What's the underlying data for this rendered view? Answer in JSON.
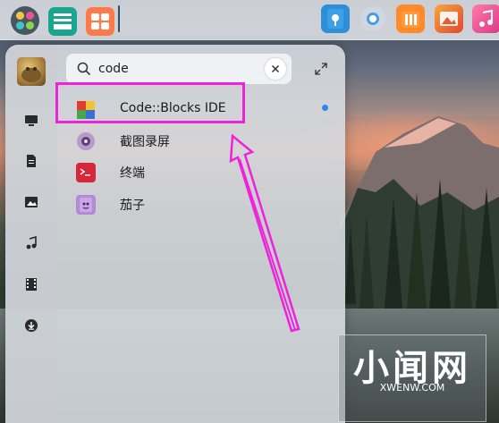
{
  "dock": {
    "apps": [
      {
        "name": "launcher"
      },
      {
        "name": "multitask-view"
      },
      {
        "name": "app-store-grid"
      },
      {
        "name": "file-manager"
      },
      {
        "name": "chrome-browser"
      },
      {
        "name": "shopping-store"
      },
      {
        "name": "photos"
      },
      {
        "name": "music"
      }
    ]
  },
  "launcher": {
    "search": {
      "value": "code"
    },
    "results": [
      {
        "label": "Code::Blocks IDE",
        "icon": "codeblocks-icon"
      },
      {
        "label": "截图录屏",
        "icon": "screenshot-recorder-icon"
      },
      {
        "label": "终端",
        "icon": "terminal-icon"
      },
      {
        "label": "茄子",
        "icon": "cheese-camera-icon"
      }
    ],
    "sidebar": [
      "computer-icon",
      "documents-icon",
      "pictures-icon",
      "music-icon",
      "videos-icon",
      "downloads-icon"
    ]
  },
  "watermark": {
    "big": "小闻网",
    "small": "XWENW.COM"
  },
  "colors": {
    "highlight": "#ee22dd",
    "accent": "#2b86ee"
  }
}
